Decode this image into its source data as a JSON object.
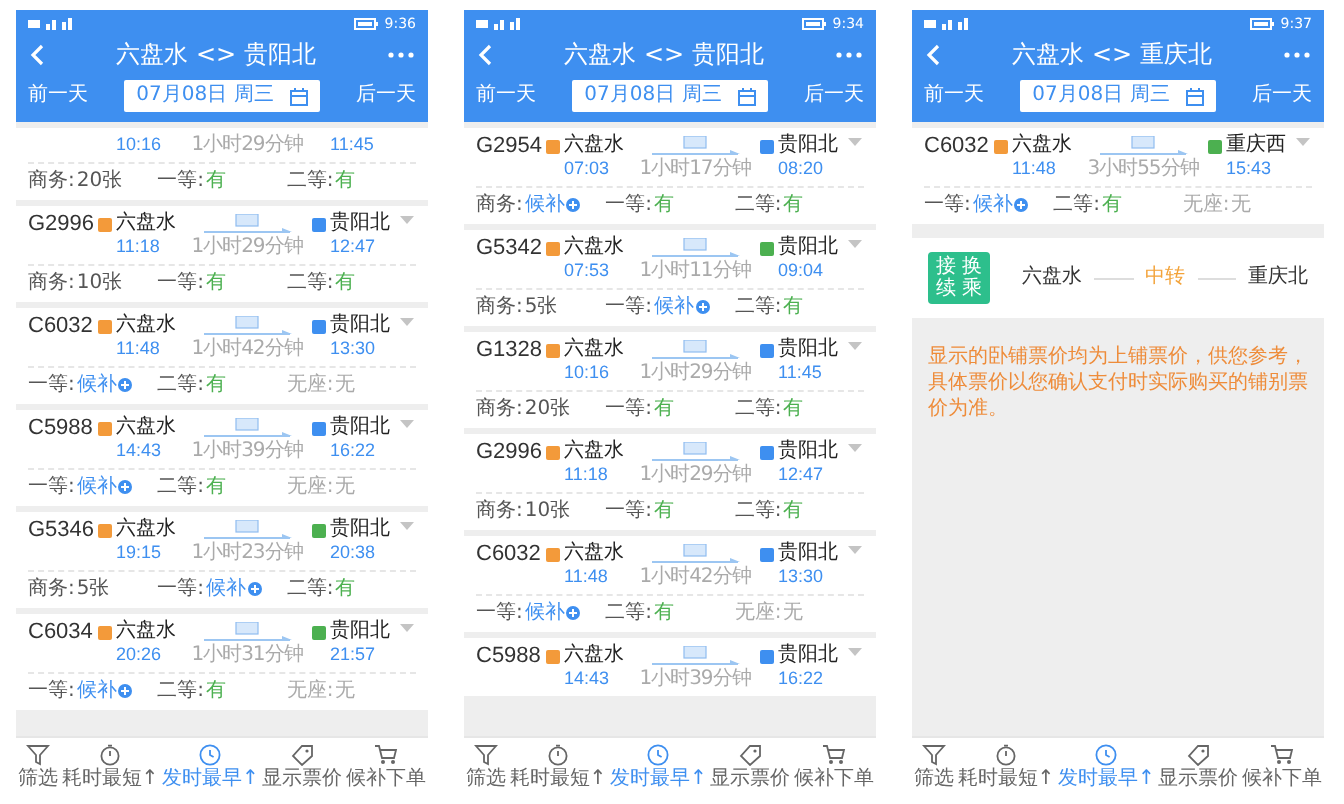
{
  "phones": [
    {
      "status_bar": {
        "time": "9:36"
      },
      "header": {
        "title": "六盘水 <> 贵阳北",
        "prev_day": "前一天",
        "date": "07月08日 周三",
        "next_day": "后一天"
      },
      "trains": [
        {
          "depart": "10:16",
          "duration": "1小时29分钟",
          "arrive": "11:45",
          "seats": [
            {
              "label": "商务:",
              "value": "20张",
              "kind": "count"
            },
            {
              "label": "一等:",
              "value": "有",
              "kind": "available"
            },
            {
              "label": "二等:",
              "value": "有",
              "kind": "available"
            }
          ]
        },
        {
          "code": "G2996",
          "from": {
            "name": "六盘水",
            "kind": "start"
          },
          "depart": "11:18",
          "duration": "1小时29分钟",
          "to": {
            "name": "贵阳北",
            "kind": "pass"
          },
          "arrive": "12:47",
          "seats": [
            {
              "label": "商务:",
              "value": "10张",
              "kind": "count"
            },
            {
              "label": "一等:",
              "value": "有",
              "kind": "available"
            },
            {
              "label": "二等:",
              "value": "有",
              "kind": "available"
            }
          ]
        },
        {
          "code": "C6032",
          "from": {
            "name": "六盘水",
            "kind": "start"
          },
          "depart": "11:48",
          "duration": "1小时42分钟",
          "to": {
            "name": "贵阳北",
            "kind": "pass"
          },
          "arrive": "13:30",
          "seats": [
            {
              "label": "一等:",
              "value": "候补",
              "kind": "waitlist"
            },
            {
              "label": "二等:",
              "value": "有",
              "kind": "available"
            },
            {
              "label": "无座:",
              "value": "无",
              "kind": "none"
            }
          ]
        },
        {
          "code": "C5988",
          "from": {
            "name": "六盘水",
            "kind": "start"
          },
          "depart": "14:43",
          "duration": "1小时39分钟",
          "to": {
            "name": "贵阳北",
            "kind": "pass"
          },
          "arrive": "16:22",
          "seats": [
            {
              "label": "一等:",
              "value": "候补",
              "kind": "waitlist"
            },
            {
              "label": "二等:",
              "value": "有",
              "kind": "available"
            },
            {
              "label": "无座:",
              "value": "无",
              "kind": "none"
            }
          ]
        },
        {
          "code": "G5346",
          "from": {
            "name": "六盘水",
            "kind": "start"
          },
          "depart": "19:15",
          "duration": "1小时23分钟",
          "to": {
            "name": "贵阳北",
            "kind": "end"
          },
          "arrive": "20:38",
          "seats": [
            {
              "label": "商务:",
              "value": "5张",
              "kind": "count"
            },
            {
              "label": "一等:",
              "value": "候补",
              "kind": "waitlist"
            },
            {
              "label": "二等:",
              "value": "有",
              "kind": "available"
            }
          ]
        },
        {
          "code": "C6034",
          "from": {
            "name": "六盘水",
            "kind": "start"
          },
          "depart": "20:26",
          "duration": "1小时31分钟",
          "to": {
            "name": "贵阳北",
            "kind": "end"
          },
          "arrive": "21:57",
          "seats": [
            {
              "label": "一等:",
              "value": "候补",
              "kind": "waitlist"
            },
            {
              "label": "二等:",
              "value": "有",
              "kind": "available"
            },
            {
              "label": "无座:",
              "value": "无",
              "kind": "none"
            }
          ]
        }
      ],
      "tab_bar": [
        {
          "label": "筛选",
          "selected": false
        },
        {
          "label": "耗时最短↑",
          "selected": false
        },
        {
          "label": "发时最早↑",
          "selected": true
        },
        {
          "label": "显示票价",
          "selected": false
        },
        {
          "label": "候补下单",
          "selected": false
        }
      ]
    },
    {
      "status_bar": {
        "time": "9:34"
      },
      "header": {
        "title": "六盘水 <> 贵阳北",
        "prev_day": "前一天",
        "date": "07月08日 周三",
        "next_day": "后一天"
      },
      "trains": [
        {
          "code": "G2954",
          "from": {
            "name": "六盘水",
            "kind": "start"
          },
          "depart": "07:03",
          "duration": "1小时17分钟",
          "to": {
            "name": "贵阳北",
            "kind": "pass"
          },
          "arrive": "08:20",
          "seats": [
            {
              "label": "商务:",
              "value": "候补",
              "kind": "waitlist"
            },
            {
              "label": "一等:",
              "value": "有",
              "kind": "available"
            },
            {
              "label": "二等:",
              "value": "有",
              "kind": "available"
            }
          ]
        },
        {
          "code": "G5342",
          "from": {
            "name": "六盘水",
            "kind": "start"
          },
          "depart": "07:53",
          "duration": "1小时11分钟",
          "to": {
            "name": "贵阳北",
            "kind": "end"
          },
          "arrive": "09:04",
          "seats": [
            {
              "label": "商务:",
              "value": "5张",
              "kind": "count"
            },
            {
              "label": "一等:",
              "value": "候补",
              "kind": "waitlist"
            },
            {
              "label": "二等:",
              "value": "有",
              "kind": "available"
            }
          ]
        },
        {
          "code": "G1328",
          "from": {
            "name": "六盘水",
            "kind": "start"
          },
          "depart": "10:16",
          "duration": "1小时29分钟",
          "to": {
            "name": "贵阳北",
            "kind": "pass"
          },
          "arrive": "11:45",
          "seats": [
            {
              "label": "商务:",
              "value": "20张",
              "kind": "count"
            },
            {
              "label": "一等:",
              "value": "有",
              "kind": "available"
            },
            {
              "label": "二等:",
              "value": "有",
              "kind": "available"
            }
          ]
        },
        {
          "code": "G2996",
          "from": {
            "name": "六盘水",
            "kind": "start"
          },
          "depart": "11:18",
          "duration": "1小时29分钟",
          "to": {
            "name": "贵阳北",
            "kind": "pass"
          },
          "arrive": "12:47",
          "seats": [
            {
              "label": "商务:",
              "value": "10张",
              "kind": "count"
            },
            {
              "label": "一等:",
              "value": "有",
              "kind": "available"
            },
            {
              "label": "二等:",
              "value": "有",
              "kind": "available"
            }
          ]
        },
        {
          "code": "C6032",
          "from": {
            "name": "六盘水",
            "kind": "start"
          },
          "depart": "11:48",
          "duration": "1小时42分钟",
          "to": {
            "name": "贵阳北",
            "kind": "pass"
          },
          "arrive": "13:30",
          "seats": [
            {
              "label": "一等:",
              "value": "候补",
              "kind": "waitlist"
            },
            {
              "label": "二等:",
              "value": "有",
              "kind": "available"
            },
            {
              "label": "无座:",
              "value": "无",
              "kind": "none"
            }
          ]
        },
        {
          "code": "C5988",
          "from": {
            "name": "六盘水",
            "kind": "start"
          },
          "depart": "14:43",
          "duration": "1小时39分钟",
          "to": {
            "name": "贵阳北",
            "kind": "pass"
          },
          "arrive": "16:22"
        }
      ],
      "tab_bar": [
        {
          "label": "筛选",
          "selected": false
        },
        {
          "label": "耗时最短↑",
          "selected": false
        },
        {
          "label": "发时最早↑",
          "selected": true
        },
        {
          "label": "显示票价",
          "selected": false
        },
        {
          "label": "候补下单",
          "selected": false
        }
      ]
    },
    {
      "status_bar": {
        "time": "9:37"
      },
      "header": {
        "title": "六盘水 <> 重庆北",
        "prev_day": "前一天",
        "date": "07月08日 周三",
        "next_day": "后一天"
      },
      "trains": [
        {
          "code": "C6032",
          "from": {
            "name": "六盘水",
            "kind": "start"
          },
          "depart": "11:48",
          "duration": "3小时55分钟",
          "to": {
            "name": "重庆西",
            "kind": "end"
          },
          "arrive": "15:43",
          "seats": [
            {
              "label": "一等:",
              "value": "候补",
              "kind": "waitlist"
            },
            {
              "label": "二等:",
              "value": "有",
              "kind": "available"
            },
            {
              "label": "无座:",
              "value": "无",
              "kind": "none"
            }
          ]
        }
      ],
      "transfer": {
        "badge_columns": [
          "接续",
          "换乘"
        ],
        "from": "六盘水",
        "via": "中转",
        "to": "重庆北"
      },
      "notice": "显示的卧铺票价均为上铺票价，供您参考，具体票价以您确认支付时实际购买的铺别票价为准。",
      "tab_bar": [
        {
          "label": "筛选",
          "selected": false
        },
        {
          "label": "耗时最短↑",
          "selected": false
        },
        {
          "label": "发时最早↑",
          "selected": true
        },
        {
          "label": "显示票价",
          "selected": false
        },
        {
          "label": "候补下单",
          "selected": false
        }
      ]
    }
  ]
}
